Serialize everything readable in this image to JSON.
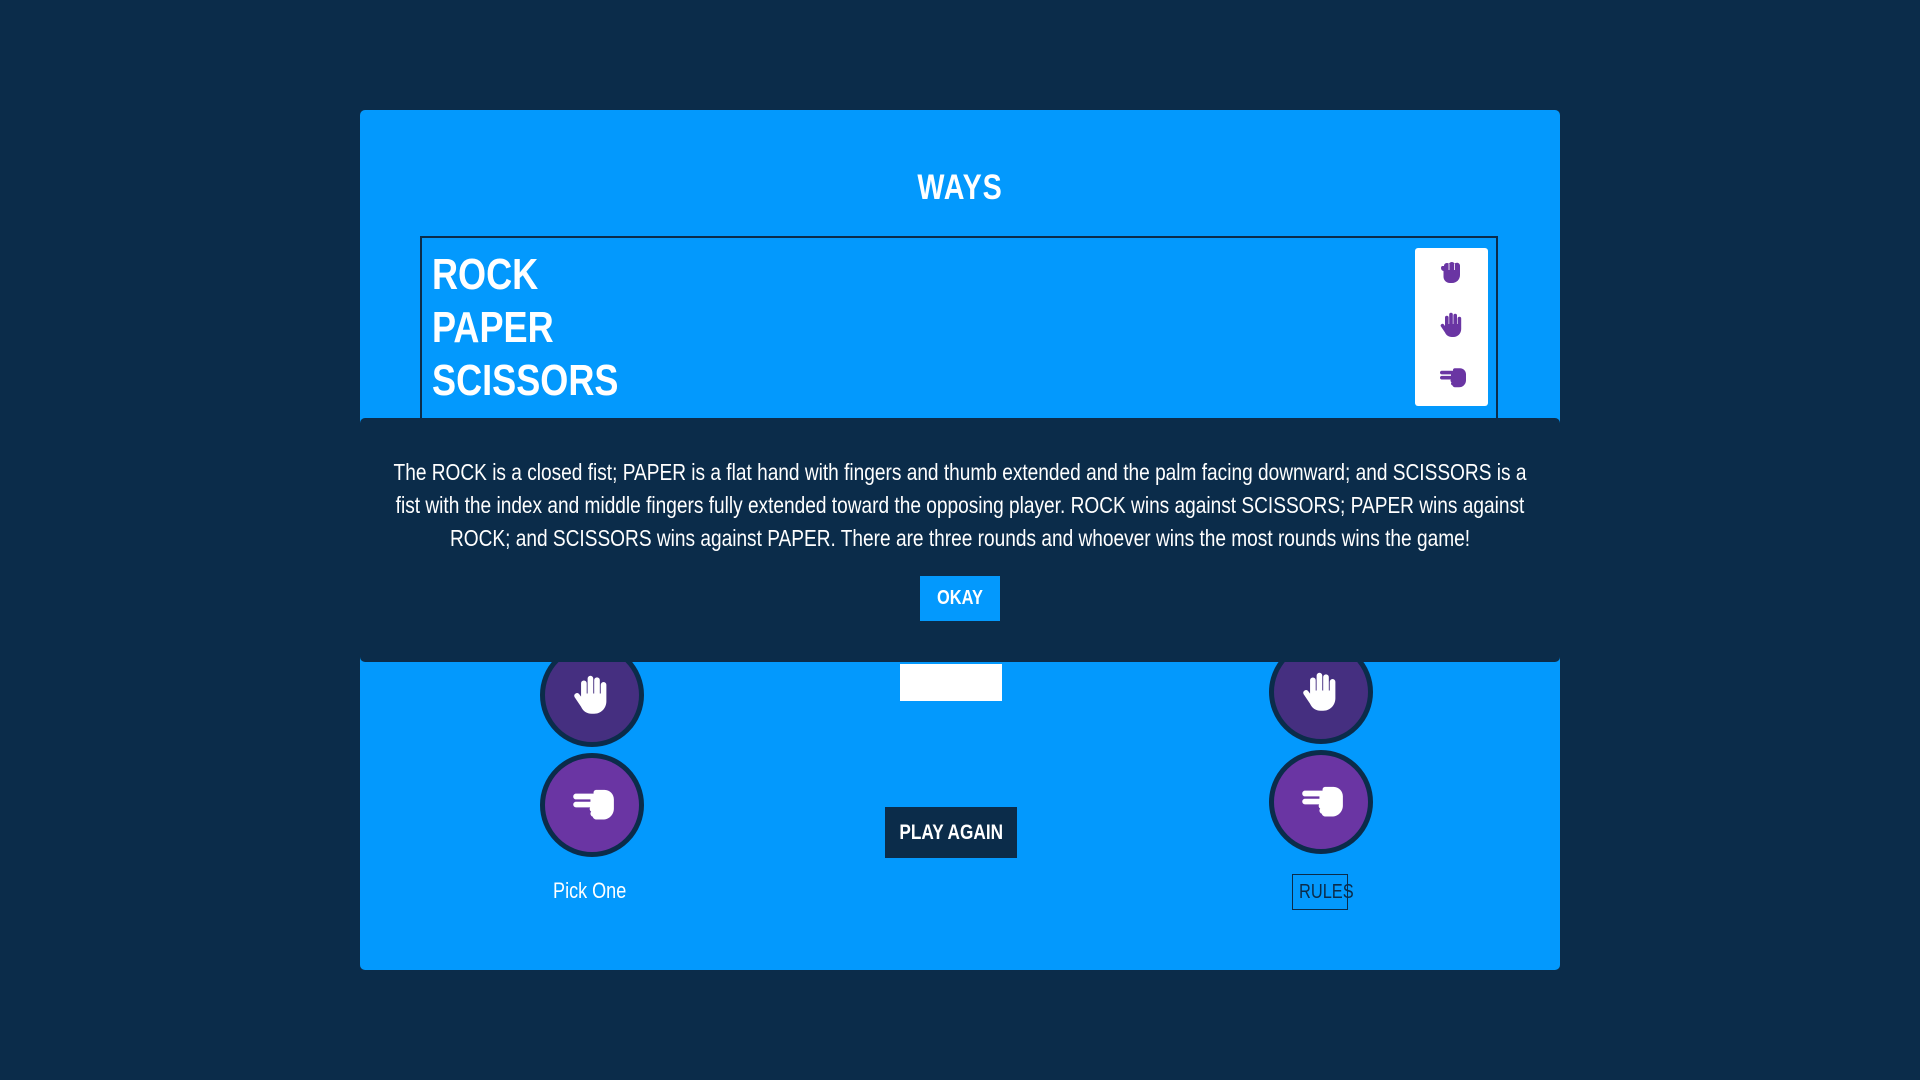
{
  "panel": {
    "title": "WAYS",
    "ways": [
      "ROCK",
      "PAPER",
      "SCISSORS"
    ],
    "way_icons": [
      "rock-icon",
      "paper-icon",
      "scissors-icon"
    ]
  },
  "game": {
    "player_choices": [
      "paper-icon",
      "scissors-icon"
    ],
    "computer_choices": [
      "paper-icon",
      "scissors-icon"
    ],
    "pick_label": "Pick One",
    "play_again_label": "PLAY AGAIN",
    "rules_label": "RULES"
  },
  "modal": {
    "rules_text": "The ROCK is a closed fist; PAPER is a flat hand with fingers and thumb extended and the palm facing downward; and SCISSORS is a fist with the index and middle fingers fully extended toward the opposing player. ROCK wins against SCISSORS; PAPER wins against ROCK; and SCISSORS wins against PAPER. There are three rounds and whoever wins the most rounds wins the game!",
    "okay_label": "OKAY"
  },
  "colors": {
    "background": "#0b2c4a",
    "panel": "#0399fd",
    "choice_dark": "#452f80",
    "choice_light": "#6a35a3",
    "icon_purple": "#6a35a3"
  }
}
